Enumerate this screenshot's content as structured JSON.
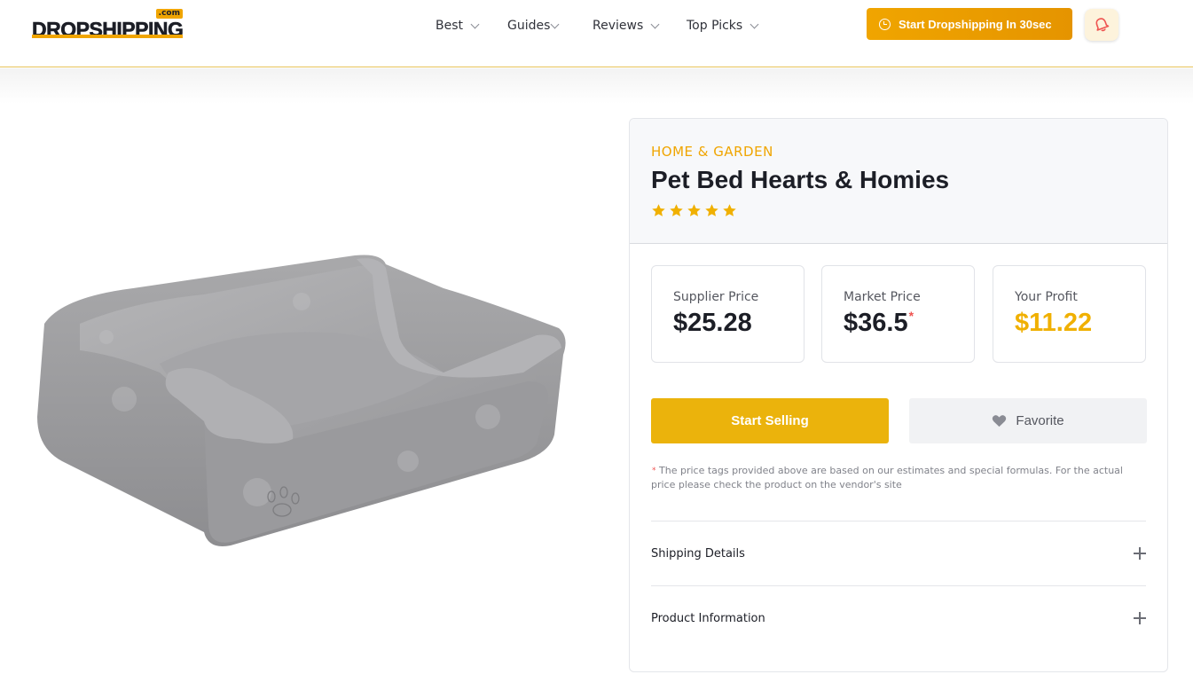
{
  "header": {
    "logo": {
      "com": ".com",
      "word": "DROPSHIPPING"
    },
    "nav": [
      {
        "label": "Best"
      },
      {
        "label": "Guides"
      },
      {
        "label": "Reviews"
      },
      {
        "label": "Top Picks"
      }
    ],
    "cta_label": "Start Dropshipping In 30sec",
    "icons": {
      "cta": "clock-icon",
      "notifications": "bell-icon"
    }
  },
  "product": {
    "category": "HOME & GARDEN",
    "title": "Pet Bed Hearts & Homies",
    "rating": 5,
    "image_icon": "pet-bed-image",
    "prices": {
      "supplier_label": "Supplier Price",
      "supplier_value": "$25.28",
      "market_label": "Market Price",
      "market_value": "$36.5",
      "market_marker": "*",
      "profit_label": "Your Profit",
      "profit_value": "$11.22"
    },
    "actions": {
      "sell_label": "Start Selling",
      "favorite_label": "Favorite"
    },
    "disclaimer_marker": "*",
    "disclaimer": "The price tags provided above are based on our estimates and special formulas. For the actual price please check the product on the vendor's site",
    "accordion": [
      {
        "label": "Shipping Details"
      },
      {
        "label": "Product Information"
      }
    ]
  },
  "colors": {
    "accent": "#f0a500",
    "sell_button": "#ebb30c",
    "profit": "#f0b000",
    "star": "#f0b000",
    "asterisk": "#ef5350"
  }
}
